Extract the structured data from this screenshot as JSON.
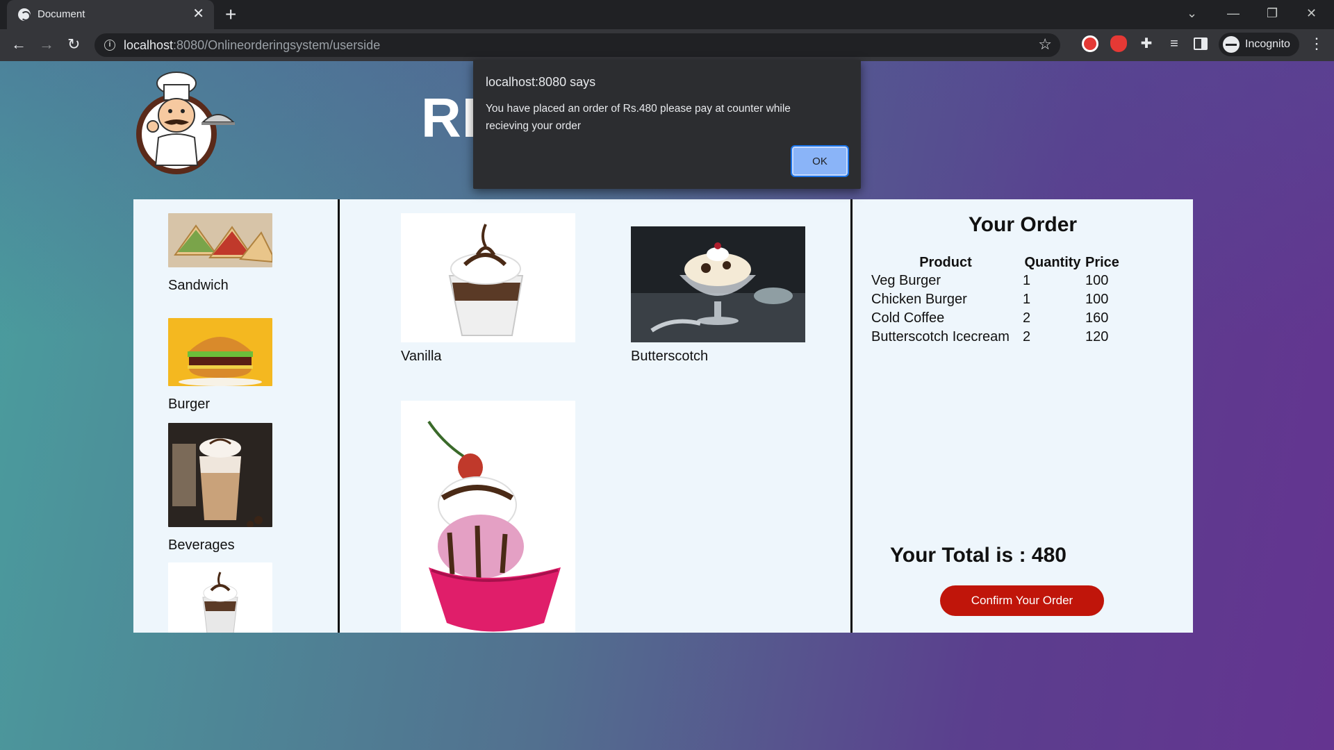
{
  "browser": {
    "tab_title": "Document",
    "tab_close": "✕",
    "new_tab": "+",
    "url_host": "localhost",
    "url_rest": ":8080/Onlineorderingsystem/userside",
    "incognito_label": "Incognito",
    "window_controls": {
      "chevron": "⌄",
      "minimize": "—",
      "restore": "❐",
      "close": "✕"
    },
    "nav": {
      "back": "←",
      "forward": "→",
      "reload": "↻"
    }
  },
  "header": {
    "brand_visible_text": "RI"
  },
  "categories": [
    {
      "label": "Sandwich"
    },
    {
      "label": "Burger"
    },
    {
      "label": "Beverages"
    },
    {
      "label": ""
    }
  ],
  "items": [
    {
      "label": "Vanilla"
    },
    {
      "label": "Butterscotch"
    },
    {
      "label": ""
    }
  ],
  "order": {
    "title": "Your Order",
    "headers": [
      "Product",
      "Quantity",
      "Price"
    ],
    "rows": [
      {
        "product": "Veg Burger",
        "quantity": "1",
        "price": "100"
      },
      {
        "product": "Chicken Burger",
        "quantity": "1",
        "price": "100"
      },
      {
        "product": "Cold Coffee",
        "quantity": "2",
        "price": "160"
      },
      {
        "product": "Butterscotch Icecream",
        "quantity": "2",
        "price": "120"
      }
    ],
    "total_text": "Your Total is : 480",
    "confirm_label": "Confirm Your Order"
  },
  "alert": {
    "title": "localhost:8080 says",
    "message": "You have placed an order of Rs.480 please pay at counter while recieving your order",
    "ok_label": "OK"
  },
  "colors": {
    "confirm_button": "#c0150a",
    "panel_bg": "#eef6fc",
    "alert_ok": "#8ab4f8"
  }
}
